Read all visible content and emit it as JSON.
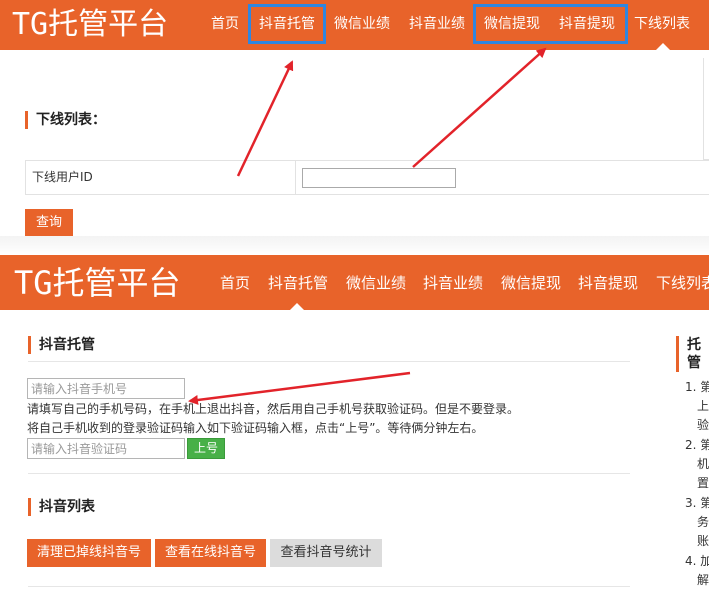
{
  "brand": {
    "tg": "TG",
    "name": "托管平台"
  },
  "nav": {
    "home": "首页",
    "douyin_manage": "抖音托管",
    "wechat_perf": "微信业绩",
    "douyin_perf": "抖音业绩",
    "wechat_withdraw": "微信提现",
    "douyin_withdraw": "抖音提现",
    "downline_list": "下线列表"
  },
  "downline": {
    "title": "下线列表：",
    "field_label": "下线用户ID",
    "field_value": "",
    "query_button": "查询"
  },
  "douyin_manage": {
    "title": "抖音托管",
    "phone_placeholder": "请输入抖音手机号",
    "instruction_1": "请填写自己的手机号码，在手机上退出抖音，然后用自己手机号获取验证码。但是不要登录。",
    "instruction_2": "将自己手机收到的登录验证码输入如下验证码输入框，点击“上号”。等待俩分钟左右。",
    "code_placeholder": "请输入抖音验证码",
    "submit_button": "上号"
  },
  "douyin_list": {
    "title": "抖音列表",
    "btn_clean": "清理已掉线抖音号",
    "btn_online": "查看在线抖音号",
    "btn_stats": "查看抖音号统计"
  },
  "side_panel": {
    "title": "托管",
    "items": [
      "1. 第",
      "上",
      "验",
      "2. 第",
      "机",
      "置",
      "3. 第",
      "务",
      "账",
      "4. 加",
      "解"
    ]
  },
  "colors": {
    "accent": "#e8632a",
    "highlight": "#2f86e0",
    "arrow": "#e2232a",
    "success": "#48b048"
  }
}
